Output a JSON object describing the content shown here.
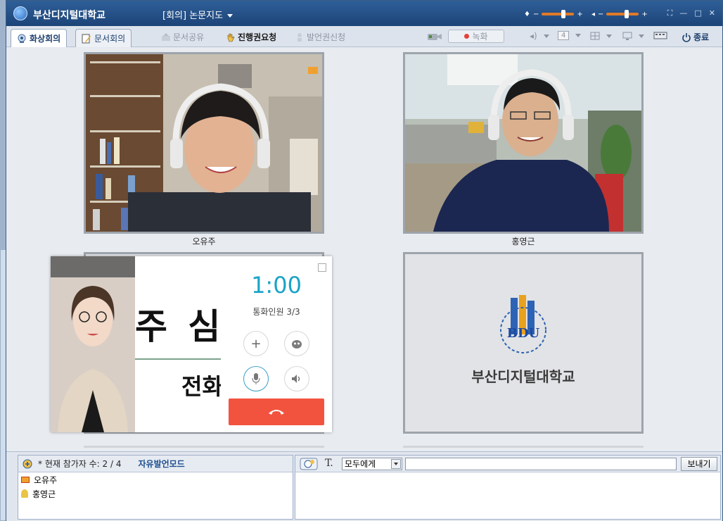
{
  "window": {
    "app_title": "부산디지털대학교",
    "meeting_title": "[회의] 논문지도"
  },
  "toolbar": {
    "tab_video": "화상회의",
    "tab_document": "문서회의",
    "doc_share": "문서공유",
    "progress_request": "진행권요청",
    "speak_request": "발언권신청",
    "record": "녹화",
    "layout_count": "4",
    "exit": "종료"
  },
  "participants_video": [
    {
      "name": "오유주"
    },
    {
      "name": "홍영근"
    }
  ],
  "logo": {
    "mark_text": "BDU",
    "university_name": "부산디지털대학교"
  },
  "call": {
    "timer": "1:00",
    "count_label": "통화인원 3/3",
    "banner_text_1": "주 심",
    "banner_text_2": "전화"
  },
  "participant_list": {
    "count_text": "* 현재 참가자 수: 2 / 4",
    "mode": "자유발언모드",
    "items": [
      {
        "name": "오유주"
      },
      {
        "name": "홍영근"
      }
    ]
  },
  "chat": {
    "recipient": "모두에게",
    "send_label": "보내기"
  },
  "colors": {
    "title_bar": "#2f5f98",
    "timer": "#1aa3c8",
    "hangup": "#f2533f",
    "slider": "#e07a28"
  }
}
